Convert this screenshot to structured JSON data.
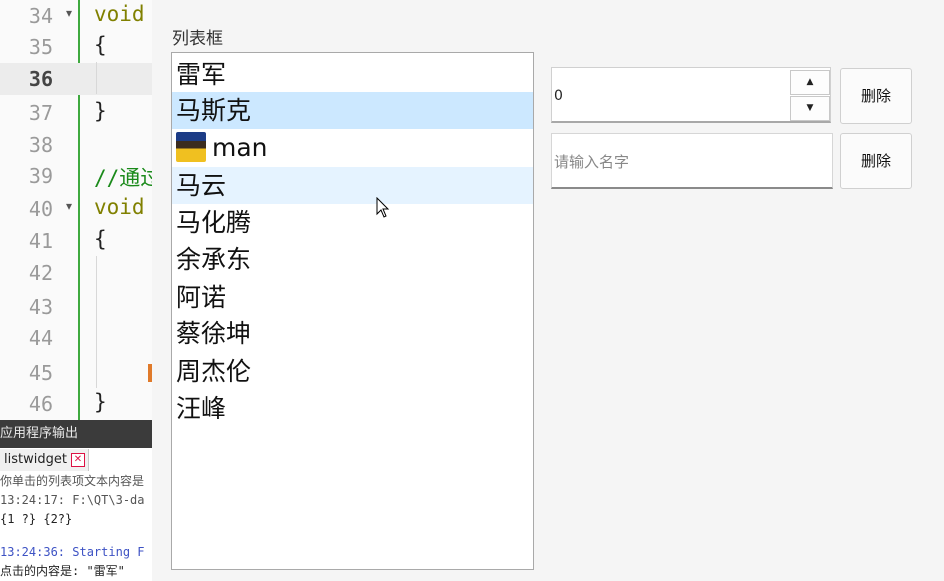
{
  "ide": {
    "lines": [
      {
        "num": "34",
        "text": "void",
        "fold": "▾",
        "kind": "kw"
      },
      {
        "num": "35",
        "text": "{",
        "fold": "",
        "kind": ""
      },
      {
        "num": "36",
        "text": "",
        "fold": "",
        "kind": "",
        "current": true
      },
      {
        "num": "37",
        "text": "}",
        "fold": "",
        "kind": ""
      },
      {
        "num": "38",
        "text": "",
        "fold": "",
        "kind": ""
      },
      {
        "num": "39",
        "text": "//通过",
        "fold": "",
        "kind": "cm"
      },
      {
        "num": "40",
        "text": "void",
        "fold": "▾",
        "kind": "kw"
      },
      {
        "num": "41",
        "text": "{",
        "fold": "",
        "kind": ""
      },
      {
        "num": "42",
        "text": "",
        "fold": "",
        "kind": ""
      },
      {
        "num": "43",
        "text": "",
        "fold": "",
        "kind": ""
      },
      {
        "num": "44",
        "text": "",
        "fold": "",
        "kind": ""
      },
      {
        "num": "45",
        "text": "",
        "fold": "",
        "kind": ""
      },
      {
        "num": "46",
        "text": "}",
        "fold": "",
        "kind": ""
      }
    ],
    "output_title": "应用程序输出",
    "output_tab": "listwidget",
    "output_lines": [
      {
        "text": "你单击的列表项文本内容是",
        "kind": "gray"
      },
      {
        "text": "13:24:17: F:\\QT\\3-da",
        "kind": "gray"
      },
      {
        "text": " {1 ?} {2?}",
        "kind": ""
      },
      {
        "text": "",
        "kind": ""
      },
      {
        "text": "13:24:36: Starting F",
        "kind": "blue"
      },
      {
        "text": "点击的内容是:  \"雷军\"",
        "kind": ""
      }
    ]
  },
  "app": {
    "group_title": "列表框",
    "list_items": [
      "雷军",
      "马斯克",
      "man",
      "马云",
      "马化腾",
      "余承东",
      "阿诺",
      "蔡徐坤",
      "周杰伦",
      "汪峰"
    ],
    "selected_index": 1,
    "hover_index": 3,
    "icon_item_index": 2,
    "spinbox_value": "0",
    "spin_up": "▲",
    "spin_down": "▼",
    "name_placeholder": "请输入名字",
    "delete_button_1": "删除",
    "delete_button_2": "删除"
  }
}
